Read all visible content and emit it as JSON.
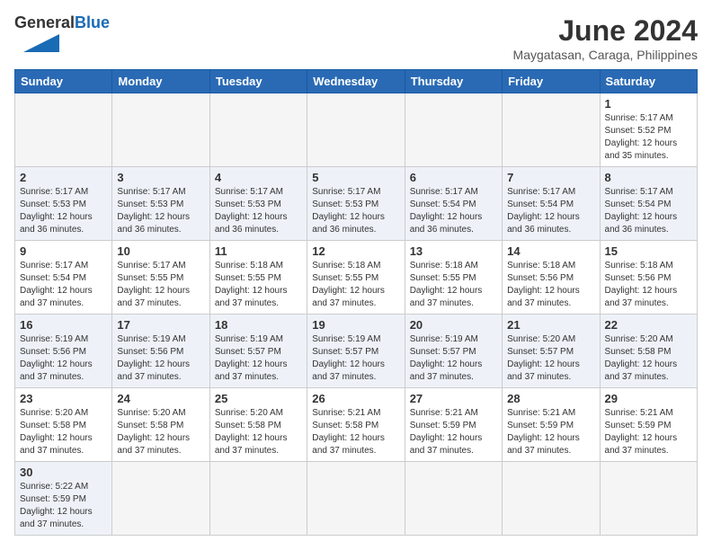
{
  "header": {
    "logo_general": "General",
    "logo_blue": "Blue",
    "month_title": "June 2024",
    "location": "Maygatasan, Caraga, Philippines"
  },
  "weekdays": [
    "Sunday",
    "Monday",
    "Tuesday",
    "Wednesday",
    "Thursday",
    "Friday",
    "Saturday"
  ],
  "weeks": [
    [
      {
        "day": "",
        "info": ""
      },
      {
        "day": "",
        "info": ""
      },
      {
        "day": "",
        "info": ""
      },
      {
        "day": "",
        "info": ""
      },
      {
        "day": "",
        "info": ""
      },
      {
        "day": "",
        "info": ""
      },
      {
        "day": "1",
        "info": "Sunrise: 5:17 AM\nSunset: 5:52 PM\nDaylight: 12 hours\nand 35 minutes."
      }
    ],
    [
      {
        "day": "2",
        "info": "Sunrise: 5:17 AM\nSunset: 5:53 PM\nDaylight: 12 hours\nand 36 minutes."
      },
      {
        "day": "3",
        "info": "Sunrise: 5:17 AM\nSunset: 5:53 PM\nDaylight: 12 hours\nand 36 minutes."
      },
      {
        "day": "4",
        "info": "Sunrise: 5:17 AM\nSunset: 5:53 PM\nDaylight: 12 hours\nand 36 minutes."
      },
      {
        "day": "5",
        "info": "Sunrise: 5:17 AM\nSunset: 5:53 PM\nDaylight: 12 hours\nand 36 minutes."
      },
      {
        "day": "6",
        "info": "Sunrise: 5:17 AM\nSunset: 5:54 PM\nDaylight: 12 hours\nand 36 minutes."
      },
      {
        "day": "7",
        "info": "Sunrise: 5:17 AM\nSunset: 5:54 PM\nDaylight: 12 hours\nand 36 minutes."
      },
      {
        "day": "8",
        "info": "Sunrise: 5:17 AM\nSunset: 5:54 PM\nDaylight: 12 hours\nand 36 minutes."
      }
    ],
    [
      {
        "day": "9",
        "info": "Sunrise: 5:17 AM\nSunset: 5:54 PM\nDaylight: 12 hours\nand 37 minutes."
      },
      {
        "day": "10",
        "info": "Sunrise: 5:17 AM\nSunset: 5:55 PM\nDaylight: 12 hours\nand 37 minutes."
      },
      {
        "day": "11",
        "info": "Sunrise: 5:18 AM\nSunset: 5:55 PM\nDaylight: 12 hours\nand 37 minutes."
      },
      {
        "day": "12",
        "info": "Sunrise: 5:18 AM\nSunset: 5:55 PM\nDaylight: 12 hours\nand 37 minutes."
      },
      {
        "day": "13",
        "info": "Sunrise: 5:18 AM\nSunset: 5:55 PM\nDaylight: 12 hours\nand 37 minutes."
      },
      {
        "day": "14",
        "info": "Sunrise: 5:18 AM\nSunset: 5:56 PM\nDaylight: 12 hours\nand 37 minutes."
      },
      {
        "day": "15",
        "info": "Sunrise: 5:18 AM\nSunset: 5:56 PM\nDaylight: 12 hours\nand 37 minutes."
      }
    ],
    [
      {
        "day": "16",
        "info": "Sunrise: 5:19 AM\nSunset: 5:56 PM\nDaylight: 12 hours\nand 37 minutes."
      },
      {
        "day": "17",
        "info": "Sunrise: 5:19 AM\nSunset: 5:56 PM\nDaylight: 12 hours\nand 37 minutes."
      },
      {
        "day": "18",
        "info": "Sunrise: 5:19 AM\nSunset: 5:57 PM\nDaylight: 12 hours\nand 37 minutes."
      },
      {
        "day": "19",
        "info": "Sunrise: 5:19 AM\nSunset: 5:57 PM\nDaylight: 12 hours\nand 37 minutes."
      },
      {
        "day": "20",
        "info": "Sunrise: 5:19 AM\nSunset: 5:57 PM\nDaylight: 12 hours\nand 37 minutes."
      },
      {
        "day": "21",
        "info": "Sunrise: 5:20 AM\nSunset: 5:57 PM\nDaylight: 12 hours\nand 37 minutes."
      },
      {
        "day": "22",
        "info": "Sunrise: 5:20 AM\nSunset: 5:58 PM\nDaylight: 12 hours\nand 37 minutes."
      }
    ],
    [
      {
        "day": "23",
        "info": "Sunrise: 5:20 AM\nSunset: 5:58 PM\nDaylight: 12 hours\nand 37 minutes."
      },
      {
        "day": "24",
        "info": "Sunrise: 5:20 AM\nSunset: 5:58 PM\nDaylight: 12 hours\nand 37 minutes."
      },
      {
        "day": "25",
        "info": "Sunrise: 5:20 AM\nSunset: 5:58 PM\nDaylight: 12 hours\nand 37 minutes."
      },
      {
        "day": "26",
        "info": "Sunrise: 5:21 AM\nSunset: 5:58 PM\nDaylight: 12 hours\nand 37 minutes."
      },
      {
        "day": "27",
        "info": "Sunrise: 5:21 AM\nSunset: 5:59 PM\nDaylight: 12 hours\nand 37 minutes."
      },
      {
        "day": "28",
        "info": "Sunrise: 5:21 AM\nSunset: 5:59 PM\nDaylight: 12 hours\nand 37 minutes."
      },
      {
        "day": "29",
        "info": "Sunrise: 5:21 AM\nSunset: 5:59 PM\nDaylight: 12 hours\nand 37 minutes."
      }
    ],
    [
      {
        "day": "30",
        "info": "Sunrise: 5:22 AM\nSunset: 5:59 PM\nDaylight: 12 hours\nand 37 minutes."
      },
      {
        "day": "",
        "info": ""
      },
      {
        "day": "",
        "info": ""
      },
      {
        "day": "",
        "info": ""
      },
      {
        "day": "",
        "info": ""
      },
      {
        "day": "",
        "info": ""
      },
      {
        "day": "",
        "info": ""
      }
    ]
  ]
}
